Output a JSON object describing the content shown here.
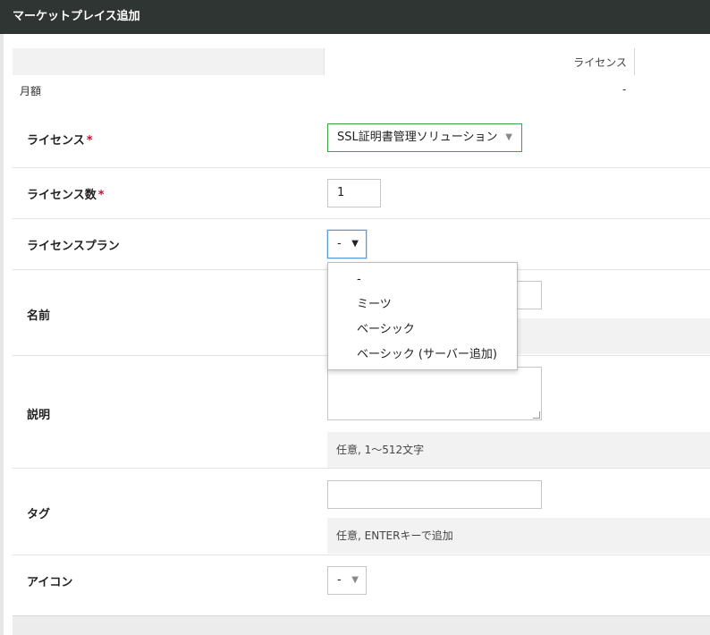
{
  "window": {
    "title": "マーケットプレイス追加"
  },
  "summary": {
    "column_header": "ライセンス",
    "monthly_label": "月額",
    "monthly_value": "-"
  },
  "form": {
    "license": {
      "label": "ライセンス",
      "required_mark": "*",
      "value": "SSL証明書管理ソリューション",
      "caret": "▼"
    },
    "license_count": {
      "label": "ライセンス数",
      "required_mark": "*",
      "value": "1"
    },
    "license_plan": {
      "label": "ライセンスプラン",
      "value": "-",
      "caret": "▼",
      "options": [
        "-",
        "ミーツ",
        "ベーシック",
        "ベーシック (サーバー追加)"
      ]
    },
    "name": {
      "label": "名前",
      "value": ""
    },
    "description": {
      "label": "説明",
      "hint": "任意, 1〜512文字"
    },
    "tag": {
      "label": "タグ",
      "hint": "任意, ENTERキーで追加"
    },
    "icon": {
      "label": "アイコン",
      "value": "-",
      "caret": "▼"
    }
  },
  "colors": {
    "titlebar_bg": "#2f3533",
    "required": "#c8102e",
    "license_select_border": "#3aa540",
    "focus_border": "#5b9bd5"
  }
}
